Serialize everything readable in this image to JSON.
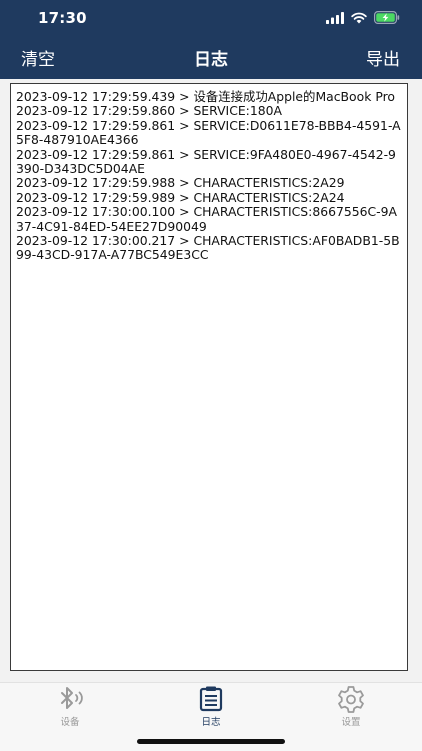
{
  "status_bar": {
    "time": "17:30",
    "icons": [
      "signal-icon",
      "wifi-icon",
      "battery-charging-icon"
    ]
  },
  "nav": {
    "left_label": "清空",
    "title": "日志",
    "right_label": "导出"
  },
  "log": {
    "lines": [
      "2023-09-12 17:29:59.439 > 设备连接成功Apple的MacBook Pro",
      "2023-09-12 17:29:59.860 > SERVICE:180A",
      "2023-09-12 17:29:59.861 > SERVICE:D0611E78-BBB4-4591-A5F8-487910AE4366",
      "2023-09-12 17:29:59.861 > SERVICE:9FA480E0-4967-4542-9390-D343DC5D04AE",
      "2023-09-12 17:29:59.988 > CHARACTERISTICS:2A29",
      "2023-09-12 17:29:59.989 > CHARACTERISTICS:2A24",
      "2023-09-12 17:30:00.100 > CHARACTERISTICS:8667556C-9A37-4C91-84ED-54EE27D90049",
      "2023-09-12 17:30:00.217 > CHARACTERISTICS:AF0BADB1-5B99-43CD-917A-A77BC549E3CC"
    ]
  },
  "tabs": [
    {
      "label": "设备",
      "icon": "bluetooth-icon",
      "active": false
    },
    {
      "label": "日志",
      "icon": "log-list-icon",
      "active": true
    },
    {
      "label": "设置",
      "icon": "gear-icon",
      "active": false
    }
  ],
  "colors": {
    "header_bg": "#1f3a5f",
    "tab_active": "#1f3a5f",
    "tab_inactive": "#9a9a9a",
    "battery_charging": "#4cd964"
  }
}
